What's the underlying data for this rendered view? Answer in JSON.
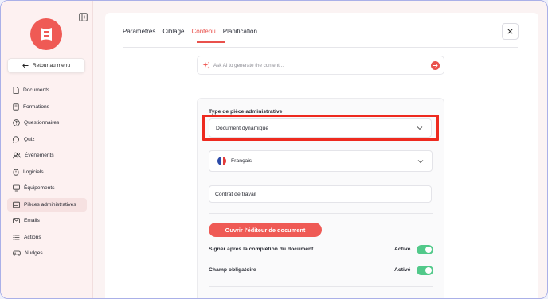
{
  "sidebar": {
    "back_label": "Retour au menu",
    "items": [
      {
        "label": "Documents",
        "icon": "document-icon"
      },
      {
        "label": "Formations",
        "icon": "book-icon"
      },
      {
        "label": "Questionnaires",
        "icon": "question-icon"
      },
      {
        "label": "Quiz",
        "icon": "chat-icon"
      },
      {
        "label": "Évènements",
        "icon": "users-icon"
      },
      {
        "label": "Logiciels",
        "icon": "power-icon"
      },
      {
        "label": "Équipements",
        "icon": "monitor-icon"
      },
      {
        "label": "Pièces administratives",
        "icon": "id-card-icon",
        "active": true
      },
      {
        "label": "Emails",
        "icon": "mail-icon"
      },
      {
        "label": "Actions",
        "icon": "list-icon"
      },
      {
        "label": "Nudges",
        "icon": "gamepad-icon"
      }
    ]
  },
  "tabs": [
    {
      "label": "Paramètres"
    },
    {
      "label": "Ciblage"
    },
    {
      "label": "Contenu",
      "active": true
    },
    {
      "label": "Planification"
    }
  ],
  "ai": {
    "placeholder": "Ask AI to generate the content..."
  },
  "form": {
    "type_label": "Type de pièce administrative",
    "type_value": "Document dynamique",
    "language_value": "Français",
    "title_value": "Contrat de travail",
    "editor_button": "Ouvrir l'éditeur de document",
    "toggles": [
      {
        "label": "Signer après la complétion du document",
        "state": "Activé"
      },
      {
        "label": "Champ obligatoire",
        "state": "Activé"
      }
    ]
  },
  "colors": {
    "accent": "#ef5a55",
    "toggle_on": "#52c98a",
    "highlight": "#ee2a1f"
  }
}
